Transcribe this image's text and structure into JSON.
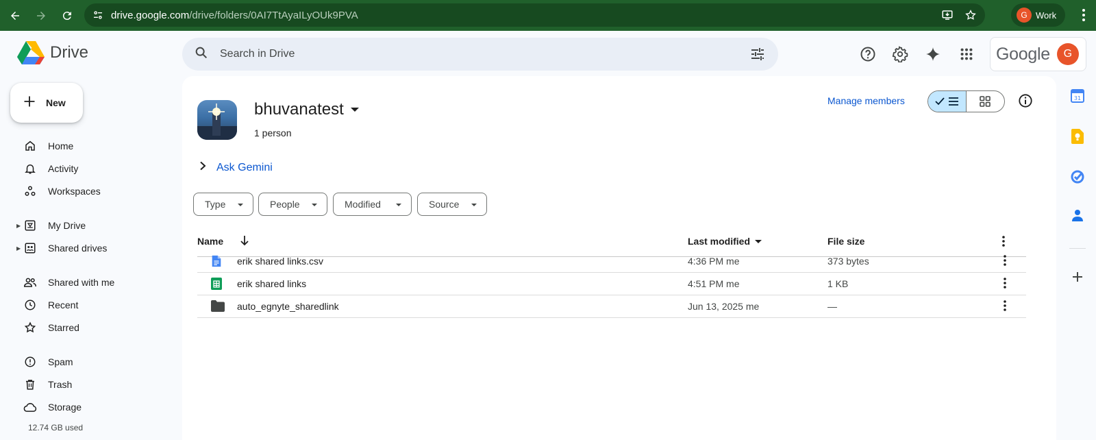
{
  "browser": {
    "url_domain": "drive.google.com",
    "url_path": "/drive/folders/0AI7TtAyaILyOUk9PVA",
    "profile_initial": "G",
    "profile_label": "Work"
  },
  "header": {
    "logo_text": "Drive",
    "search_placeholder": "Search in Drive",
    "account_brand": "Google",
    "account_initial": "G"
  },
  "sidebar": {
    "new_label": "New",
    "items": [
      {
        "label": "Home",
        "icon": "home-icon"
      },
      {
        "label": "Activity",
        "icon": "bell-icon"
      },
      {
        "label": "Workspaces",
        "icon": "workspaces-icon"
      },
      {
        "label": "My Drive",
        "icon": "my-drive-icon"
      },
      {
        "label": "Shared drives",
        "icon": "shared-drives-icon"
      },
      {
        "label": "Shared with me",
        "icon": "people-icon"
      },
      {
        "label": "Recent",
        "icon": "clock-icon"
      },
      {
        "label": "Starred",
        "icon": "star-icon"
      },
      {
        "label": "Spam",
        "icon": "spam-icon"
      },
      {
        "label": "Trash",
        "icon": "trash-icon"
      },
      {
        "label": "Storage",
        "icon": "cloud-icon"
      }
    ],
    "storage_used": "12.74 GB used"
  },
  "folder": {
    "title": "bhuvanatest",
    "members": "1 person",
    "manage_members": "Manage members",
    "ask_gemini": "Ask Gemini"
  },
  "filters": [
    "Type",
    "People",
    "Modified",
    "Source"
  ],
  "table": {
    "headers": {
      "name": "Name",
      "modified": "Last modified",
      "size": "File size"
    },
    "rows": [
      {
        "name": "erik shared links.csv",
        "modified": "4:36 PM me",
        "size": "373 bytes",
        "icon": "docs-icon"
      },
      {
        "name": "erik shared links",
        "modified": "4:51 PM me",
        "size": "1 KB",
        "icon": "sheets-icon"
      },
      {
        "name": "auto_egnyte_sharedlink",
        "modified": "Jun 13, 2025 me",
        "size": "—",
        "icon": "folder-icon"
      }
    ]
  },
  "colors": {
    "browser_bar": "#20602b",
    "accent": "#0b57d0",
    "toggle_active": "#c2e7ff",
    "avatar": "#e8542a"
  }
}
